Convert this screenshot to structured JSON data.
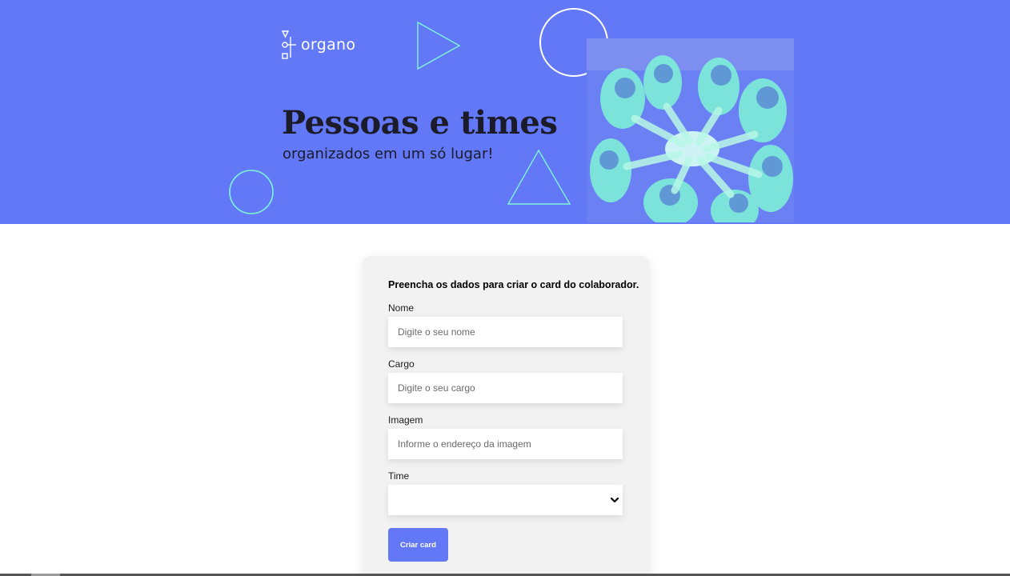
{
  "brand": {
    "name": "organo",
    "primary_color": "#6278f7",
    "accent_color": "#7ef5d6",
    "logo_icon": "org-chart-icon"
  },
  "hero": {
    "title": "Pessoas e times",
    "subtitle": "organizados em um só lugar!",
    "image_icon": "team-hands-photo"
  },
  "form": {
    "heading": "Preencha os dados para criar o card do colaborador.",
    "fields": [
      {
        "label": "Nome",
        "placeholder": "Digite o seu nome",
        "value": ""
      },
      {
        "label": "Cargo",
        "placeholder": "Digite o seu cargo",
        "value": ""
      },
      {
        "label": "Imagem",
        "placeholder": "Informe o endereço da imagem",
        "value": ""
      }
    ],
    "select": {
      "label": "Time",
      "selected": "",
      "chevron_icon": "chevron-down-icon"
    },
    "submit_label": "Criar card"
  }
}
